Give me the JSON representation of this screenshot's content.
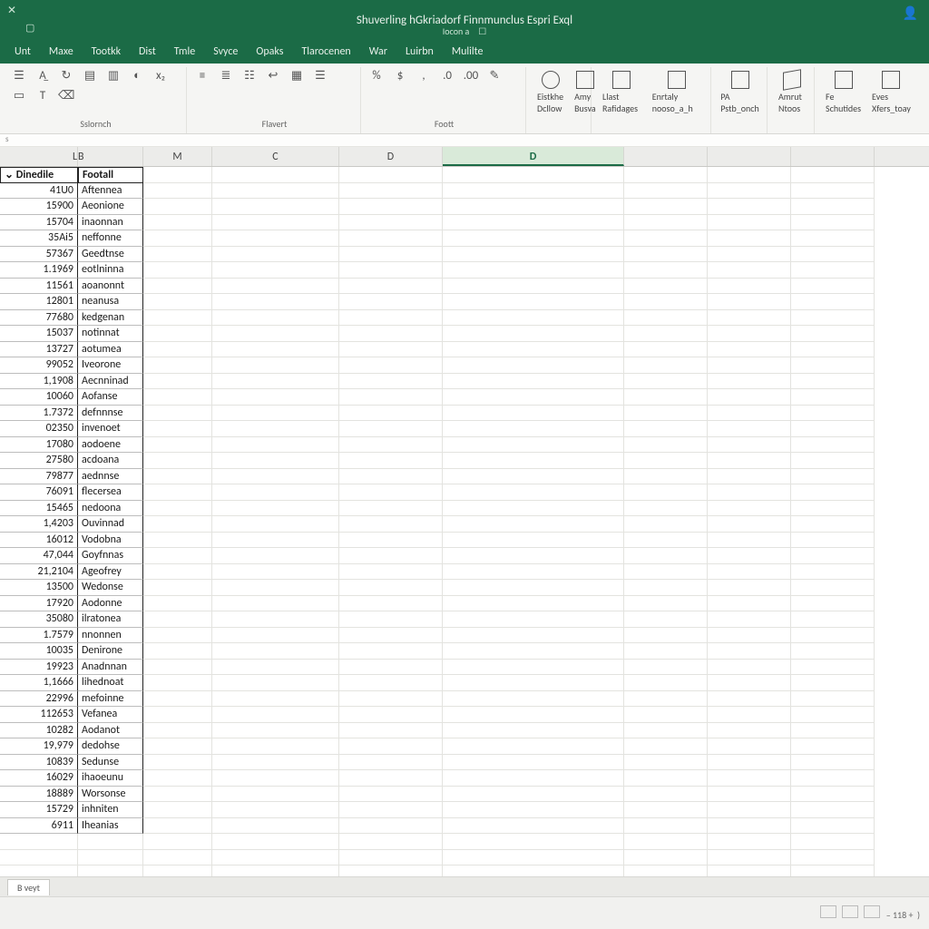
{
  "titlebar": {
    "title": "Shuverling hGkriadorf Finnmunclus Espri Exql",
    "subtitle": "Iocon a"
  },
  "menu": {
    "items": [
      "Unt",
      "Maxe",
      "Tootkk",
      "Dist",
      "Tmle",
      "Svyce",
      "Opaks",
      "Tlarocenen",
      "War",
      "Luirbn",
      "Mulilte"
    ]
  },
  "ribbon": {
    "groupLabels": [
      "Sslornch",
      "Flavert",
      "Foott"
    ],
    "big": [
      {
        "label": "Eistkhe Dcllow"
      },
      {
        "label": "Amy Busva"
      },
      {
        "label": "Llast Rafidages"
      },
      {
        "label": "Enrtaly nooso_a_h"
      },
      {
        "label": "PA Pstb_onch"
      },
      {
        "label": "Amrut Ntoos"
      },
      {
        "label": "Fe Schutides"
      },
      {
        "label": "Eves Xfers_toay"
      }
    ]
  },
  "columns": [
    "L",
    "B",
    "M",
    "C",
    "D",
    "D"
  ],
  "table": {
    "headers": [
      "Dinedile",
      "Footall"
    ],
    "rows": [
      [
        "41U0",
        "Aftennea"
      ],
      [
        "15900",
        "Aeonione"
      ],
      [
        "15704",
        "inaonnan"
      ],
      [
        "35Ai5",
        "neffonne"
      ],
      [
        "57367",
        "Geedtnse"
      ],
      [
        "1.1969",
        "eotlninna"
      ],
      [
        "11561",
        "aoanonnt"
      ],
      [
        "12801",
        "neanusa"
      ],
      [
        "77680",
        "kedgenan"
      ],
      [
        "15037",
        "notinnat"
      ],
      [
        "13727",
        "aotumea"
      ],
      [
        "99052",
        "Iveorone"
      ],
      [
        "1,1908",
        "Aecnninad"
      ],
      [
        "10060",
        "Aofanse"
      ],
      [
        "1.7372",
        "defnnnse"
      ],
      [
        "02350",
        "invenoet"
      ],
      [
        "17080",
        "aodoene"
      ],
      [
        "27580",
        "acdoana"
      ],
      [
        "79877",
        "aednnse"
      ],
      [
        "76091",
        "flecersea"
      ],
      [
        "15465",
        "nedoona"
      ],
      [
        "1,4203",
        "Ouvinnad"
      ],
      [
        "16012",
        "Vodobna"
      ],
      [
        "47,044",
        "Goyfnnas"
      ],
      [
        "21,2104",
        "Ageofrey"
      ],
      [
        "13500",
        "Wedonse"
      ],
      [
        "17920",
        "Aodonne"
      ],
      [
        "35080",
        "ilratonea"
      ],
      [
        "1.7579",
        "nnonnen"
      ],
      [
        "10035",
        "Denirone"
      ],
      [
        "19923",
        "Anadnnan"
      ],
      [
        "1,1666",
        "lihednoat"
      ],
      [
        "22996",
        "mefoinne"
      ],
      [
        "112653",
        "Vefanea"
      ],
      [
        "10282",
        "Aodanot"
      ],
      [
        "19,979",
        "dedohse"
      ],
      [
        "10839",
        "Sedunse"
      ],
      [
        "16029",
        "ihaoeunu"
      ],
      [
        "18889",
        "Worsonse"
      ],
      [
        "15729",
        "inhniten"
      ],
      [
        "6911",
        "Iheanias"
      ]
    ]
  },
  "sheetTab": "B veyt",
  "status": {
    "left": "",
    "zoom": "118"
  }
}
